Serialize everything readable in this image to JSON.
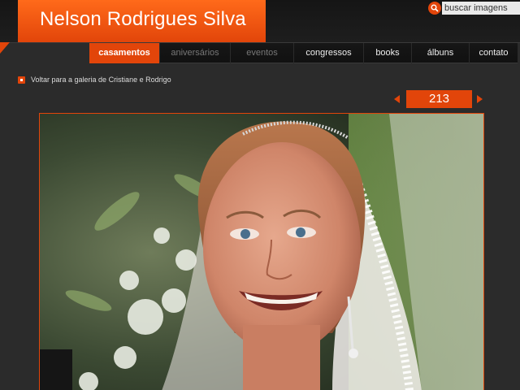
{
  "site": {
    "title": "Nelson Rodrigues Silva"
  },
  "search": {
    "placeholder": "buscar imagens",
    "icon": "search-icon"
  },
  "nav": {
    "items": [
      {
        "label": "casamentos",
        "state": "active"
      },
      {
        "label": "aniversários",
        "state": "muted"
      },
      {
        "label": "eventos",
        "state": "muted"
      },
      {
        "label": "congressos",
        "state": "normal"
      },
      {
        "label": "books",
        "state": "normal"
      },
      {
        "label": "álbuns",
        "state": "normal"
      },
      {
        "label": "contato",
        "state": "normal"
      }
    ]
  },
  "breadcrumb": {
    "back_label": "Voltar para a galeria de Cristiane e Rodrigo"
  },
  "pager": {
    "current": "213"
  },
  "photo": {
    "subject": "bride-portrait"
  },
  "colors": {
    "accent": "#e2450a",
    "background": "#2b2b2b",
    "topbar": "#151515"
  }
}
